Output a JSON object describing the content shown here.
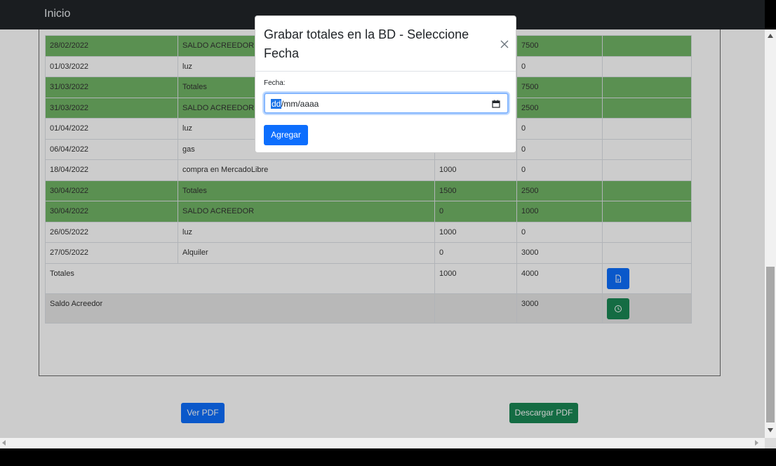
{
  "navbar": {
    "brand": "Inicio"
  },
  "ledger": {
    "rows": [
      {
        "fecha": "28/02/2022",
        "detalle": "SALDO ACREEDOR",
        "debe": "",
        "haber": "7500",
        "style": "green"
      },
      {
        "fecha": "01/03/2022",
        "detalle": "luz",
        "debe": "",
        "haber": "0",
        "style": "white"
      },
      {
        "fecha": "31/03/2022",
        "detalle": "Totales",
        "debe": "",
        "haber": "7500",
        "style": "green"
      },
      {
        "fecha": "31/03/2022",
        "detalle": "SALDO ACREEDOR",
        "debe": "",
        "haber": "2500",
        "style": "green"
      },
      {
        "fecha": "01/04/2022",
        "detalle": "luz",
        "debe": "",
        "haber": "0",
        "style": "white"
      },
      {
        "fecha": "06/04/2022",
        "detalle": "gas",
        "debe": "",
        "haber": "0",
        "style": "white"
      },
      {
        "fecha": "18/04/2022",
        "detalle": "compra en MercadoLibre",
        "debe": "1000",
        "haber": "0",
        "style": "white"
      },
      {
        "fecha": "30/04/2022",
        "detalle": "Totales",
        "debe": "1500",
        "haber": "2500",
        "style": "green"
      },
      {
        "fecha": "30/04/2022",
        "detalle": "SALDO ACREEDOR",
        "debe": "0",
        "haber": "1000",
        "style": "green"
      },
      {
        "fecha": "26/05/2022",
        "detalle": "luz",
        "debe": "1000",
        "haber": "0",
        "style": "white"
      },
      {
        "fecha": "27/05/2022",
        "detalle": "Alquiler",
        "debe": "0",
        "haber": "3000",
        "style": "white"
      }
    ],
    "totales": {
      "label": "Totales",
      "debe": "1000",
      "haber": "4000"
    },
    "saldo": {
      "label": "Saldo Acreedor",
      "debe": "",
      "haber": "3000"
    }
  },
  "buttons": {
    "ver_pdf": "Ver PDF",
    "descargar_pdf": "Descargar PDF"
  },
  "modal": {
    "title": "Grabar totales en la BD - Seleccione Fecha",
    "label": "Fecha:",
    "date_dd": "dd",
    "date_rest": "/mm/aaaa",
    "submit": "Agregar"
  },
  "colors": {
    "green_row": "#71b466",
    "primary": "#0d6efd",
    "success": "#198754",
    "navbar": "#212529"
  },
  "icons": {
    "close": "close-icon",
    "calendar": "calendar-icon",
    "pdf": "file-pdf-icon",
    "save": "save-icon"
  }
}
